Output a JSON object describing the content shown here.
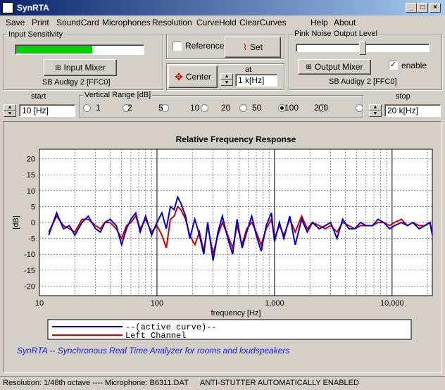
{
  "app": {
    "title": "SynRTA"
  },
  "menu": [
    "Save",
    "Print",
    "SoundCard",
    "Microphones",
    "Resolution",
    "CurveHold",
    "ClearCurves",
    "Help",
    "About"
  ],
  "input_sensitivity": {
    "label": "Input Sensitivity",
    "level": 0.6,
    "mixer_button": "Input Mixer",
    "device": "SB Audigy 2 [FFC0]"
  },
  "reference": {
    "checkbox_label": "Reference",
    "checked": false,
    "set_button": "Set",
    "center_button": "Center",
    "at_label": "at",
    "at_value": "1 k[Hz]"
  },
  "pink_noise": {
    "label": "Pink Noise Output Level",
    "level": 0.5,
    "mixer_button": "Output Mixer",
    "enable_label": "enable",
    "enabled": true,
    "device": "SB Audigy 2 [FFC0]"
  },
  "start": {
    "label": "start",
    "value": "10 [Hz]"
  },
  "stop": {
    "label": "stop",
    "value": "20 k[Hz]"
  },
  "vertical_range": {
    "label": "Vertical Range [dB]",
    "options": [
      "1",
      "2",
      "5",
      "10",
      "20",
      "50",
      "100",
      "200"
    ],
    "selected": "50"
  },
  "chart_data": {
    "type": "line",
    "title": "Relative Frequency Response",
    "xlabel": "frequency [Hz]",
    "ylabel": "[dB]",
    "xscale": "log",
    "xlim": [
      10,
      22000
    ],
    "ylim": [
      -23,
      23
    ],
    "xticks": [
      {
        "value": 10,
        "label": "10"
      },
      {
        "value": 100,
        "label": "100"
      },
      {
        "value": 1000,
        "label": "1,000"
      },
      {
        "value": 10000,
        "label": "10,000"
      }
    ],
    "yticks": [
      20,
      15,
      10,
      5,
      0,
      -5,
      -10,
      -15,
      -20
    ],
    "grid": true,
    "legend_position": "bottom-left",
    "series": [
      {
        "name": "--(active curve)--",
        "color": "#0000cc",
        "x": [
          12,
          14,
          16,
          18,
          20,
          23,
          26,
          30,
          33,
          36,
          40,
          45,
          50,
          55,
          60,
          66,
          72,
          80,
          90,
          100,
          110,
          120,
          130,
          140,
          150,
          160,
          175,
          190,
          210,
          230,
          250,
          270,
          300,
          330,
          360,
          400,
          440,
          480,
          530,
          580,
          640,
          700,
          770,
          850,
          940,
          1000,
          1100,
          1200,
          1350,
          1500,
          1700,
          1900,
          2100,
          2400,
          2700,
          3000,
          3400,
          3800,
          4300,
          4800,
          5400,
          6000,
          6800,
          7600,
          8500,
          9500,
          10500,
          12000,
          13500,
          15000,
          17000,
          19000,
          21000,
          22000
        ],
        "y": [
          -4,
          3,
          -2,
          -1,
          -4,
          0,
          2,
          -2,
          -3,
          0,
          1,
          -1,
          -7,
          -2,
          1,
          3,
          -3,
          2,
          -4,
          0,
          3,
          -2,
          5,
          4,
          8,
          6,
          2,
          -5,
          1,
          -4,
          -10,
          0,
          -12,
          -3,
          2,
          -5,
          -10,
          1,
          -8,
          -3,
          2,
          -4,
          -9,
          -1,
          3,
          -6,
          0,
          -5,
          2,
          -7,
          1,
          -3,
          0,
          -2,
          -1,
          0,
          -5,
          1,
          -2,
          -2,
          0,
          -1,
          -1,
          1,
          0,
          -2,
          -1,
          0,
          -1,
          0,
          -2,
          -1,
          0,
          -4
        ]
      },
      {
        "name": "Left Channel",
        "color": "#cc0000",
        "x": [
          12,
          14,
          16,
          18,
          20,
          23,
          26,
          30,
          33,
          36,
          40,
          45,
          50,
          55,
          60,
          66,
          72,
          80,
          90,
          100,
          110,
          120,
          130,
          140,
          150,
          160,
          175,
          190,
          210,
          230,
          250,
          270,
          300,
          330,
          360,
          400,
          440,
          480,
          530,
          580,
          640,
          700,
          770,
          850,
          940,
          1000,
          1100,
          1200,
          1350,
          1500,
          1700,
          1900,
          2100,
          2400,
          2700,
          3000,
          3400,
          3800,
          4300,
          4800,
          5400,
          6000,
          6800,
          7600,
          8500,
          9500,
          10500,
          12000,
          13500,
          15000,
          17000,
          19000,
          21000,
          22000
        ],
        "y": [
          -3,
          2,
          -1,
          -2,
          -3,
          1,
          1,
          -1,
          -2,
          0,
          0,
          -2,
          -5,
          -1,
          0,
          2,
          -2,
          1,
          -3,
          -1,
          -4,
          -8,
          1,
          2,
          5,
          4,
          1,
          -4,
          -7,
          -3,
          -9,
          -1,
          -10,
          -4,
          0,
          -4,
          -8,
          -1,
          -7,
          -2,
          0,
          -3,
          -7,
          -2,
          1,
          -5,
          -1,
          -4,
          1,
          -3,
          2,
          -2,
          0,
          -1,
          -2,
          -1,
          -3,
          0,
          -1,
          -2,
          -1,
          -1,
          -1,
          0,
          0,
          -1,
          0,
          1,
          -1,
          0,
          -1,
          -1,
          0,
          -3
        ]
      }
    ]
  },
  "caption": "SynRTA -- Synchronous Real Time Analyzer for rooms and loudspeakers",
  "status": {
    "resolution": "Resolution: 1/48th octave ---- Microphone: B6311.DAT",
    "message": "ANTI-STUTTER AUTOMATICALLY ENABLED"
  }
}
